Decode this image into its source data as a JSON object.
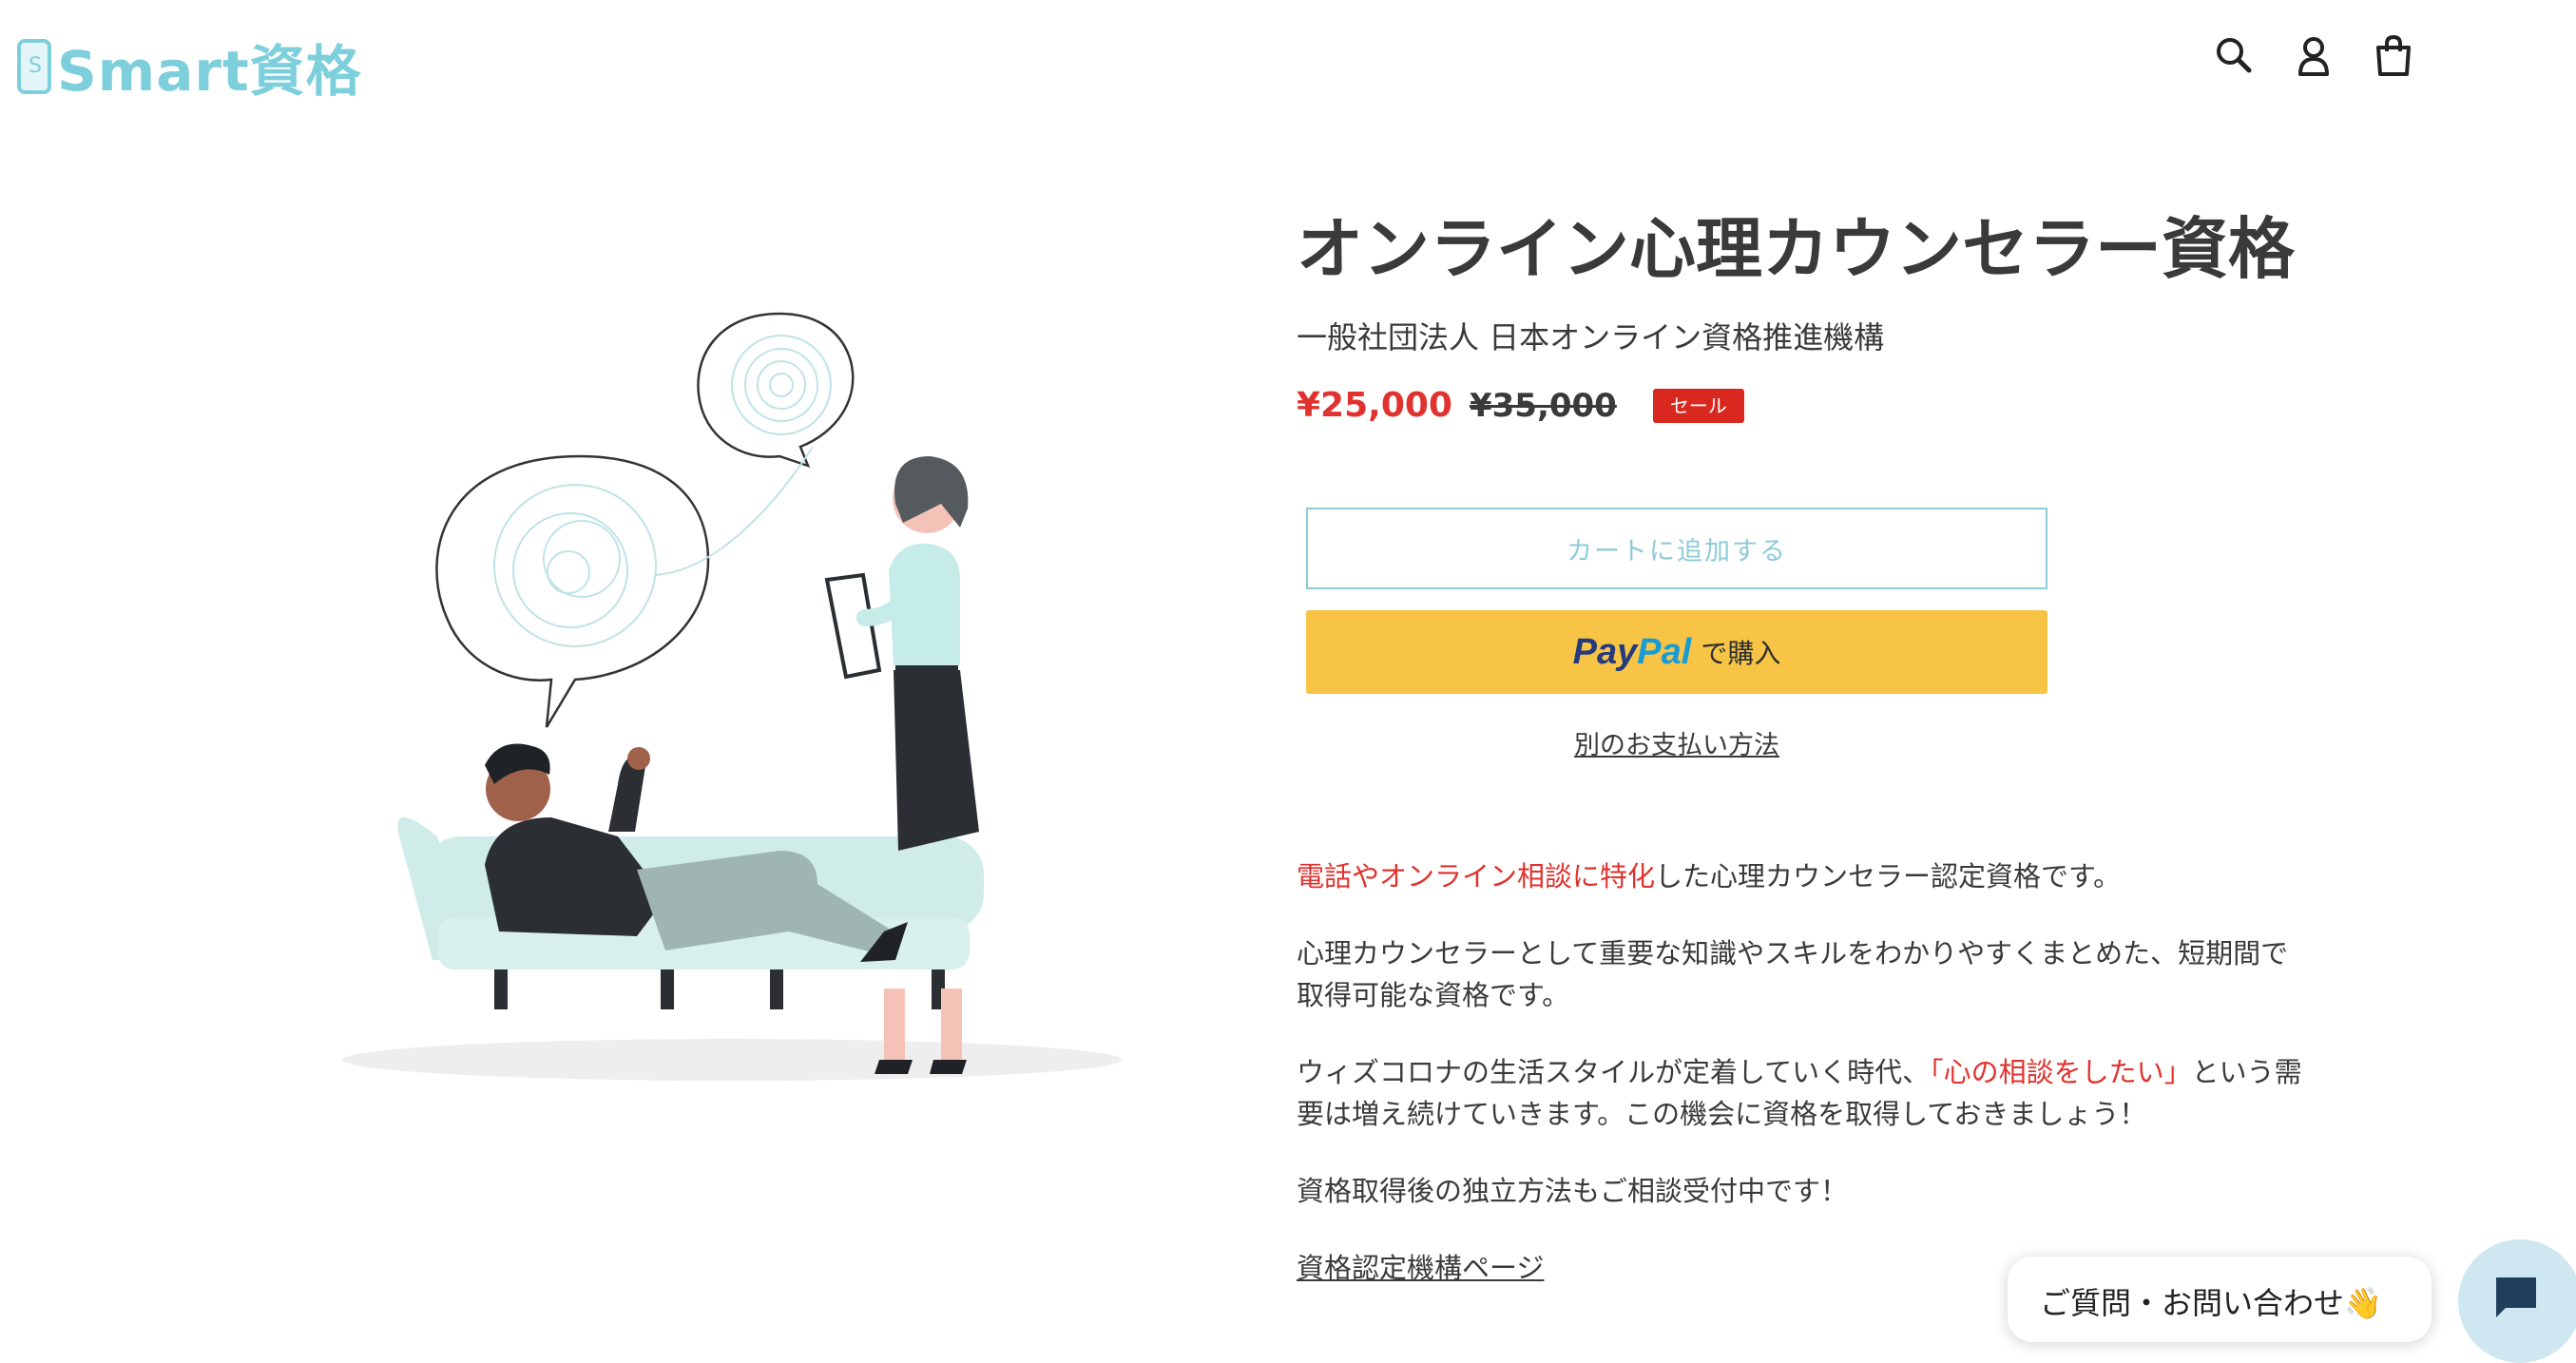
{
  "header": {
    "logo_mark": "S",
    "logo_text": "Smart資格",
    "icons": [
      "search-icon",
      "account-icon",
      "cart-icon"
    ]
  },
  "product": {
    "title": "オンライン心理カウンセラー資格",
    "vendor": "一般社団法人 日本オンライン資格推進機構",
    "price_sale": "¥25,000",
    "price_regular": "¥35,000",
    "sale_badge": "セール",
    "add_to_cart": "カートに追加する",
    "paypal_pay": "Pay",
    "paypal_pal": "Pal",
    "paypal_suffix": "で購入",
    "other_payment": "別のお支払い方法"
  },
  "description": {
    "p1_highlight": "電話やオンライン相談に特化",
    "p1_rest": "した心理カウンセラー認定資格です。",
    "p2": "心理カウンセラーとして重要な知識やスキルをわかりやすくまとめた、短期間で取得可能な資格です。",
    "p3_start": "ウィズコロナの生活スタイルが定着していく時代、",
    "p3_highlight": "「心の相談をしたい」",
    "p3_end": "という需要は増え続けていきます。この機会に資格を取得しておきましょう！",
    "p4": "資格取得後の独立方法もご相談受付中です！",
    "link": "資格認定機構ページ"
  },
  "chat": {
    "bubble_text": "ご質問・お問い合わせ👋"
  },
  "colors": {
    "brand": "#7ecfdc",
    "sale": "#e0322e",
    "paypal": "#f7c446"
  }
}
